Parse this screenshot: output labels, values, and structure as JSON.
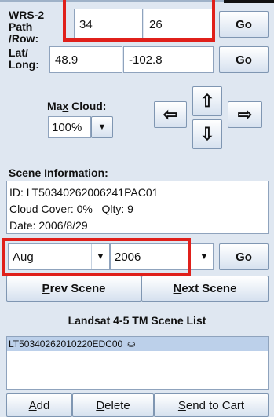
{
  "wrs": {
    "label_line1": "WRS-2",
    "label_line2": "Path /Row:",
    "path": "34",
    "row": "26",
    "go": "Go"
  },
  "latlong": {
    "label_line1": "Lat/",
    "label_line2": "Long:",
    "lat": "48.9",
    "long": "-102.8",
    "go": "Go"
  },
  "max_cloud": {
    "label_pre": "Ma",
    "label_u": "x",
    "label_post": " Cloud:",
    "value": "100%"
  },
  "arrows": {
    "left": "⇦",
    "up": "⇧",
    "down": "⇩",
    "right": "⇨"
  },
  "scene_info": {
    "label": "Scene Information:",
    "id_line": "ID: LT50340262006241PAC01",
    "cloud_line": "Cloud Cover: 0%   Qlty: 9",
    "date_line": "Date: 2006/8/29"
  },
  "date_select": {
    "month": "Aug",
    "year": "2006",
    "go": "Go"
  },
  "scene_nav": {
    "prev_u": "P",
    "prev_rest": "rev Scene",
    "next_u": "N",
    "next_rest": "ext Scene"
  },
  "scene_list": {
    "title": "Landsat 4-5 TM Scene List",
    "items": [
      {
        "id": "LT50340262010220EDC00"
      }
    ]
  },
  "bottom_buttons": {
    "add_u": "A",
    "add_rest": "dd",
    "delete_u": "D",
    "delete_rest": "elete",
    "cart_u": "S",
    "cart_rest": "end to Cart"
  }
}
